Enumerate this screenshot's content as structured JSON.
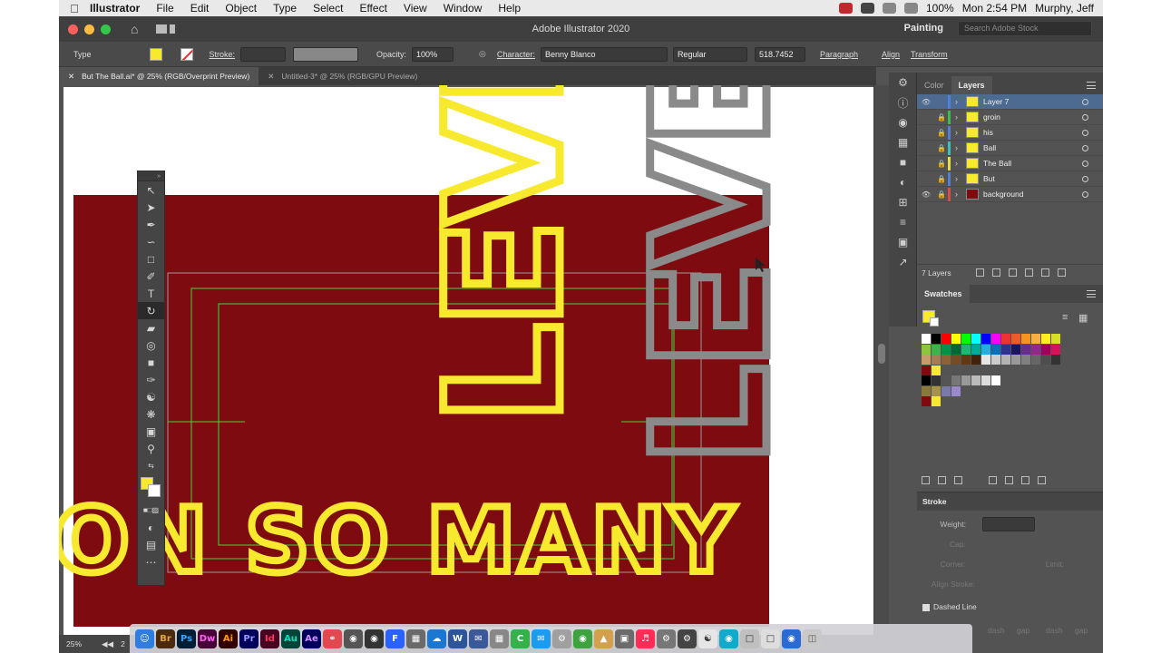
{
  "menubar": {
    "app_name": "Illustrator",
    "items": [
      "File",
      "Edit",
      "Object",
      "Type",
      "Select",
      "Effect",
      "View",
      "Window",
      "Help"
    ],
    "battery": "100%",
    "clock": "Mon 2:54 PM",
    "user": "Murphy, Jeff"
  },
  "titlebar": {
    "title": "Adobe Illustrator 2020",
    "workspace": "Painting",
    "stock_placeholder": "Search Adobe Stock"
  },
  "controlbar": {
    "type_label": "Type",
    "stroke_label": "Stroke:",
    "opacity_label": "Opacity:",
    "opacity_value": "100%",
    "character_label": "Character:",
    "font_family": "Benny Blanco",
    "font_style": "Regular",
    "font_size": "518.7452",
    "paragraph_label": "Paragraph",
    "align_label": "Align",
    "transform_label": "Transform"
  },
  "tabs": [
    {
      "label": "But The Ball.ai* @ 25% (RGB/Overprint Preview)",
      "active": true
    },
    {
      "label": "Untitled-3* @ 25% (RGB/GPU Preview)",
      "active": false
    }
  ],
  "canvas": {
    "level_text": "LEVEL",
    "bottom_text": "ON SO MANY"
  },
  "layers_panel": {
    "tabs": [
      "Color",
      "Layers"
    ],
    "layers": [
      {
        "name": "Layer 7",
        "color": "#4f7fe0",
        "visible": true,
        "locked": false,
        "selected": true
      },
      {
        "name": "groin",
        "color": "#36c24a",
        "visible": false,
        "locked": true,
        "selected": false
      },
      {
        "name": "his",
        "color": "#4f7fe0",
        "visible": false,
        "locked": true,
        "selected": false
      },
      {
        "name": "Ball",
        "color": "#36c2c0",
        "visible": false,
        "locked": true,
        "selected": false
      },
      {
        "name": "The Ball",
        "color": "#e6df3a",
        "visible": false,
        "locked": true,
        "selected": false
      },
      {
        "name": "But",
        "color": "#4f7fe0",
        "visible": false,
        "locked": true,
        "selected": false
      },
      {
        "name": "background",
        "color": "#e04848",
        "visible": true,
        "locked": true,
        "selected": false
      }
    ],
    "count_label": "7 Layers"
  },
  "swatches_panel": {
    "title": "Swatches",
    "rows": [
      [
        "#ffffff",
        "#000000",
        "#ff0000",
        "#ffff00",
        "#00ff00",
        "#00ffff",
        "#0000ff",
        "#ff00ff",
        "#ee3333",
        "#f15a24",
        "#f7931e",
        "#fbb03b",
        "#fcee21",
        "#d9e021"
      ],
      [
        "#8cc63f",
        "#39b54a",
        "#009245",
        "#006837",
        "#22b573",
        "#00a99d",
        "#29abe2",
        "#0071bc",
        "#2e3192",
        "#1b1464",
        "#662d91",
        "#93278f",
        "#9e005d",
        "#d4145a"
      ],
      [
        "#c69c6d",
        "#a67c52",
        "#8c6239",
        "#754c24",
        "#603813",
        "#42210b",
        "#e6e6e6",
        "#cccccc",
        "#b3b3b3",
        "#999999",
        "#808080",
        "#666666",
        "#4d4d4d",
        "#333333"
      ],
      [
        "#7d0b0f",
        "#f7e92e"
      ],
      [
        "#000000",
        "#333333",
        "#555555",
        "#777777",
        "#999999",
        "#bbbbbb",
        "#dddddd",
        "#ffffff"
      ],
      [
        "#8a7a3a",
        "#a89440",
        "#7a7aa8",
        "#9a8acc"
      ],
      [
        "#7d0b0f",
        "#f7e92e"
      ]
    ]
  },
  "stroke_panel": {
    "title": "Stroke",
    "weight_label": "Weight:",
    "cap_label": "Cap:",
    "corner_label": "Corner:",
    "limit_label": "Limit:",
    "align_label": "Align Stroke:",
    "dashed_label": "Dashed Line",
    "dash_labels": [
      "dash",
      "gap",
      "dash",
      "gap"
    ]
  },
  "statusbar": {
    "zoom": "25%",
    "artboard": "2"
  },
  "dock_apps": [
    "Finder",
    "Br",
    "Ps",
    "Dw",
    "Ai",
    "Pr",
    "Id",
    "Au",
    "Ae"
  ],
  "colors": {
    "artboard_red": "#7d0b0f",
    "text_yellow": "#f7e92e",
    "text_gray": "#888888",
    "guide_green": "#42d542",
    "ui_dark": "#535353"
  }
}
